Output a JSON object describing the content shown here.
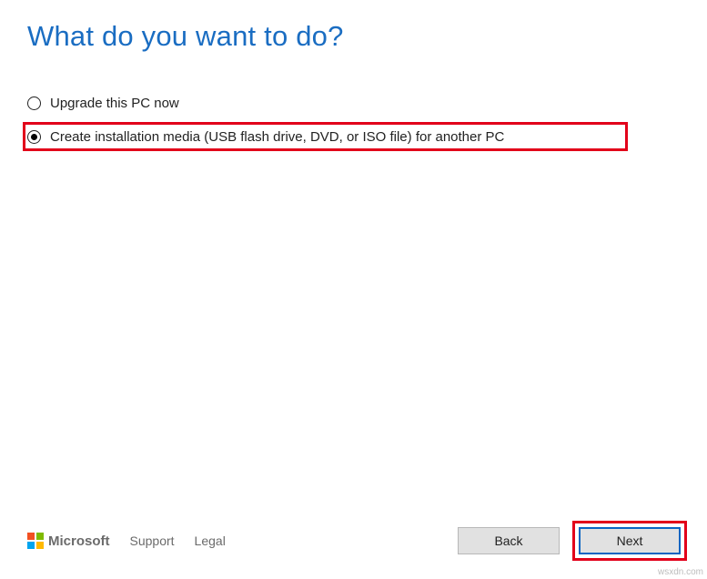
{
  "title": "What do you want to do?",
  "options": [
    {
      "label": "Upgrade this PC now",
      "selected": false,
      "highlighted": false
    },
    {
      "label": "Create installation media (USB flash drive, DVD, or ISO file) for another PC",
      "selected": true,
      "highlighted": true
    }
  ],
  "footer": {
    "brand": "Microsoft",
    "links": {
      "support": "Support",
      "legal": "Legal"
    },
    "buttons": {
      "back": "Back",
      "next": "Next"
    }
  },
  "watermark": "wsxdn.com"
}
